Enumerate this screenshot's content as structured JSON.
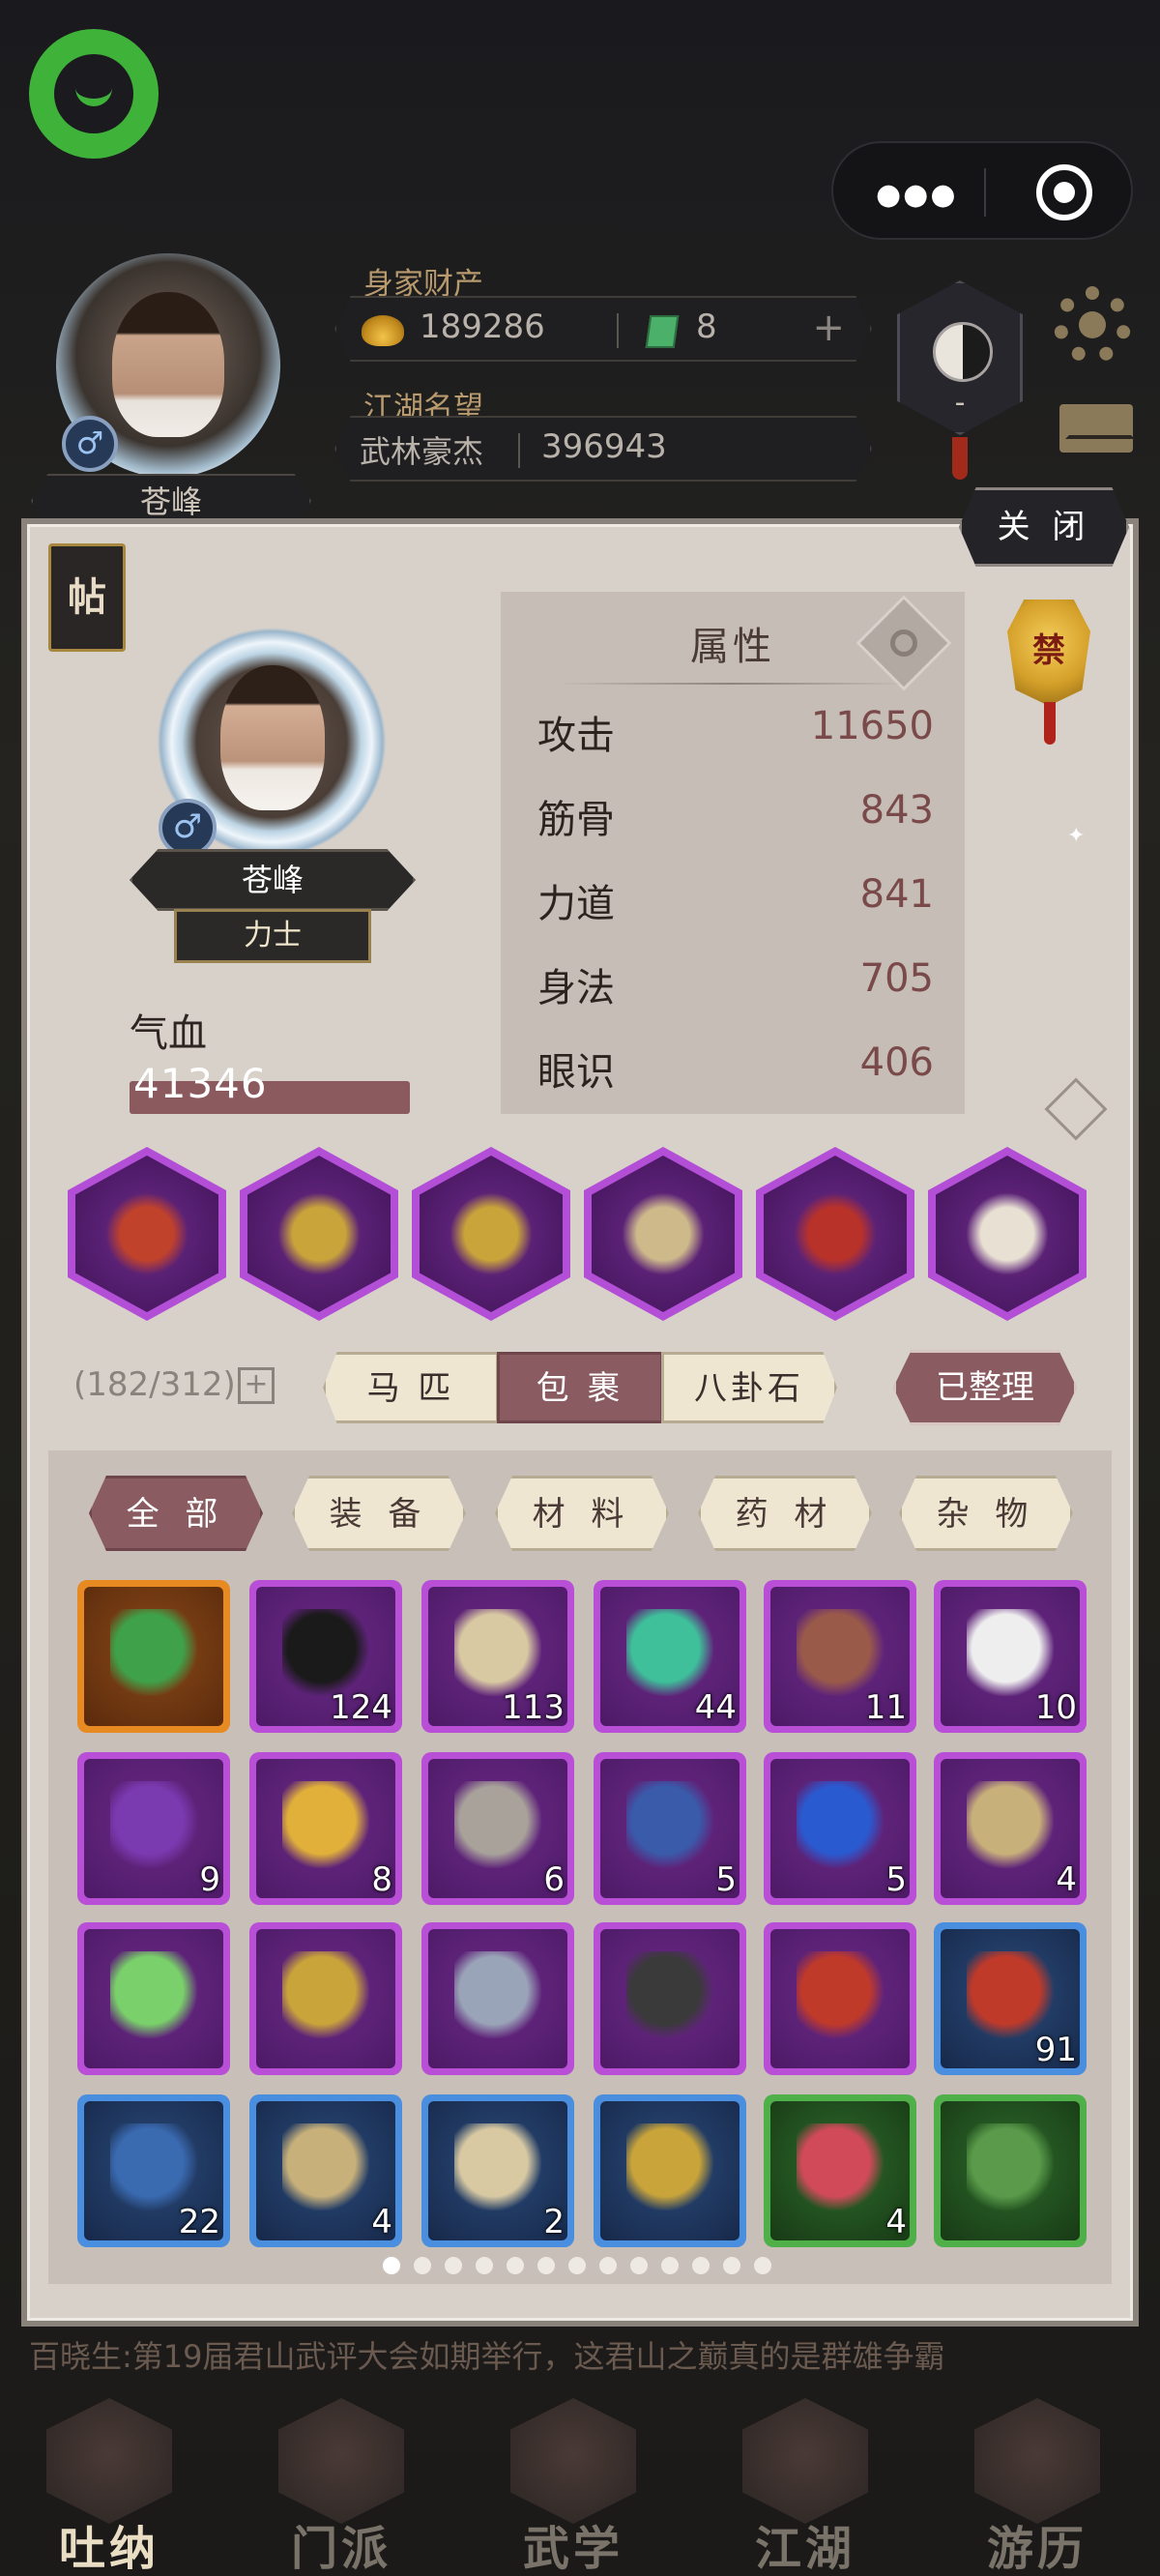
{
  "header": {
    "player_name": "苍峰",
    "gender_symbol": "♂",
    "wealth_label": "身家财产",
    "silver": "189286",
    "jade": "8",
    "fame_label": "江湖名望",
    "fame_title": "武林豪杰",
    "fame_value": "396943",
    "taiji_badge_text": "-"
  },
  "panel": {
    "close_label": "关 闭",
    "tie_label": "帖",
    "ban_label": "禁",
    "character": {
      "name": "苍峰",
      "class": "力士",
      "hp_label": "气血",
      "hp_value": "41346"
    },
    "attributes": {
      "title": "属性",
      "rows": [
        {
          "label": "攻击",
          "value": "11650"
        },
        {
          "label": "筋骨",
          "value": "843"
        },
        {
          "label": "力道",
          "value": "841"
        },
        {
          "label": "身法",
          "value": "705"
        },
        {
          "label": "眼识",
          "value": "406"
        }
      ]
    },
    "equipment": [
      {
        "icon": "sword-icon",
        "color": "#c0422b"
      },
      {
        "icon": "armor-icon",
        "color": "#c9a43a"
      },
      {
        "icon": "ring-icon",
        "color": "#c9a43a"
      },
      {
        "icon": "boots-icon",
        "color": "#cdb98a"
      },
      {
        "icon": "amulet-icon",
        "color": "#b8322a"
      },
      {
        "icon": "horse-icon",
        "color": "#e8e0d2"
      }
    ],
    "bag": {
      "count": "(182/312)",
      "tabs": [
        "马 匹",
        "包 裹",
        "八卦石"
      ],
      "active_tab": 1,
      "sorted_label": "已整理",
      "categories": [
        "全 部",
        "装 备",
        "材 料",
        "药 材",
        "杂 物"
      ],
      "active_category": 0,
      "items": [
        {
          "rarity": "orange",
          "icon": "jade-disc-icon",
          "color": "#3fa14a",
          "qty": ""
        },
        {
          "rarity": "purple",
          "icon": "black-disc-icon",
          "color": "#1a1a1a",
          "qty": "124"
        },
        {
          "rarity": "purple",
          "icon": "letter-icon",
          "color": "#d8c9a2",
          "qty": "113"
        },
        {
          "rarity": "purple",
          "icon": "green-orb-icon",
          "color": "#3fbf9a",
          "qty": "44"
        },
        {
          "rarity": "purple",
          "icon": "meat-icon",
          "color": "#9a5a4a",
          "qty": "11"
        },
        {
          "rarity": "purple",
          "icon": "cotton-icon",
          "color": "#eeeeee",
          "qty": "10"
        },
        {
          "rarity": "purple",
          "icon": "purple-gem-icon",
          "color": "#7a3ab0",
          "qty": "9"
        },
        {
          "rarity": "purple",
          "icon": "gold-ore-icon",
          "color": "#e0b03a",
          "qty": "8"
        },
        {
          "rarity": "purple",
          "icon": "stele-icon",
          "color": "#a8a29a",
          "qty": "6"
        },
        {
          "rarity": "purple",
          "icon": "blue-sand-icon",
          "color": "#3a5aaa",
          "qty": "5"
        },
        {
          "rarity": "purple",
          "icon": "sapphire-icon",
          "color": "#2a5ad0",
          "qty": "5"
        },
        {
          "rarity": "purple",
          "icon": "paper-icon",
          "color": "#c8b07a",
          "qty": "4"
        },
        {
          "rarity": "purple",
          "icon": "jade-token-icon",
          "color": "#7ad06a",
          "qty": ""
        },
        {
          "rarity": "purple",
          "icon": "gold-armor-icon",
          "color": "#c9a43a",
          "qty": ""
        },
        {
          "rarity": "purple",
          "icon": "crystal-icon",
          "color": "#9aa4b8",
          "qty": ""
        },
        {
          "rarity": "purple",
          "icon": "oil-jar-icon",
          "color": "#3a3a3a",
          "qty": ""
        },
        {
          "rarity": "purple",
          "icon": "red-book-icon",
          "color": "#c03a2a",
          "qty": ""
        },
        {
          "rarity": "blue",
          "icon": "horse-token-icon",
          "color": "#c03a2a",
          "qty": "91"
        },
        {
          "rarity": "blue",
          "icon": "pouch-icon",
          "color": "#3a6ab0",
          "qty": "22"
        },
        {
          "rarity": "blue",
          "icon": "parchment-icon",
          "color": "#c8b07a",
          "qty": "4"
        },
        {
          "rarity": "blue",
          "icon": "scroll-icon",
          "color": "#d8c9a2",
          "qty": "2"
        },
        {
          "rarity": "blue",
          "icon": "bagua-pendant-icon",
          "color": "#c9a43a",
          "qty": ""
        },
        {
          "rarity": "green",
          "icon": "peach-icon",
          "color": "#d04a5a",
          "qty": "4"
        },
        {
          "rarity": "green",
          "icon": "green-ball-icon",
          "color": "#5a9a4a",
          "qty": ""
        }
      ],
      "pages": 13,
      "current_page": 0
    }
  },
  "ticker": "百晓生:第19届君山武评大会如期举行，这君山之巅真的是群雄争霸",
  "nav": [
    {
      "label": "吐纳",
      "icon": "gourd-icon"
    },
    {
      "label": "门派",
      "icon": "banner-icon"
    },
    {
      "label": "武学",
      "icon": "books-icon"
    },
    {
      "label": "江湖",
      "icon": "hat-icon"
    },
    {
      "label": "游历",
      "icon": "horse-icon"
    }
  ]
}
